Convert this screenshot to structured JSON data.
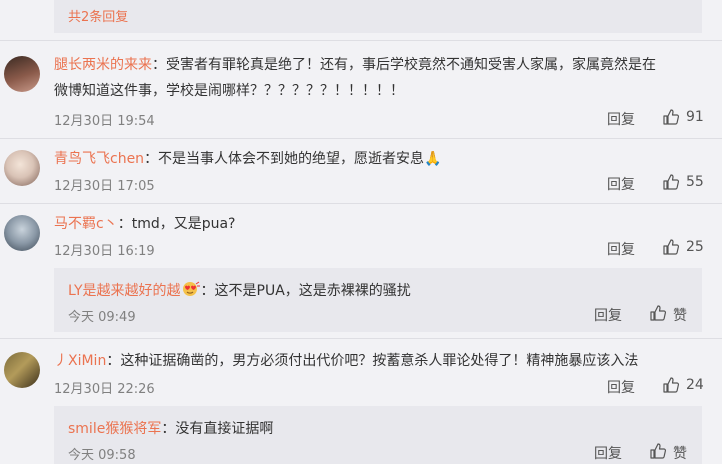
{
  "top": {
    "reply_count_link": "共2条回复"
  },
  "comments": [
    {
      "author": "腿长两米的来来",
      "text_line1": "：受害者有罪轮真是绝了！还有，事后学校竟然不通知受害人家属，家属竟然是在",
      "text_line2": "微博知道这件事，学校是闹哪样？？？？？？！！！！！",
      "time": "12月30日 19:54",
      "reply_label": "回复",
      "likes": "91"
    },
    {
      "author": "青鸟飞飞chen",
      "text_line1": "：不是当事人体会不到她的绝望，愿逝者安息🙏",
      "time": "12月30日 17:05",
      "reply_label": "回复",
      "likes": "55"
    },
    {
      "author": "马不羁c丶",
      "text_line1": "：tmd，又是pua?",
      "time": "12月30日 16:19",
      "reply_label": "回复",
      "likes": "25",
      "sub_reply": {
        "author": "LY是越来越好的越",
        "text": "：这不是PUA，这是赤裸裸的骚扰",
        "time": "今天 09:49",
        "reply_label": "回复",
        "like_label": "赞"
      }
    },
    {
      "author": "丿XiMin",
      "text_line1": "：这种证据确凿的，男方必须付出代价吧？按蓄意杀人罪论处得了！精神施暴应该入法",
      "time": "12月30日 22:26",
      "reply_label": "回复",
      "likes": "24",
      "sub_reply": {
        "author": "smile猴猴将军",
        "text": "：没有直接证据啊",
        "time": "今天 09:58",
        "reply_label": "回复",
        "like_label": "赞"
      }
    }
  ],
  "colors": {
    "accent": "#eb7350",
    "background": "#f2f2f5",
    "reply_box": "#e8e8ed"
  },
  "icons": [
    "thumbs-up-icon",
    "love-emoji-icon"
  ]
}
